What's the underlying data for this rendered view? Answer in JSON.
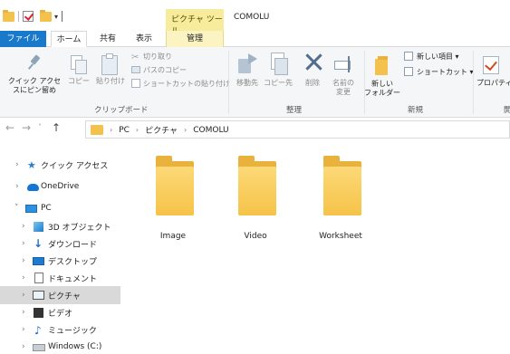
{
  "titlebar": {
    "context_tools": "ピクチャ ツール",
    "window_title": "COMOLU"
  },
  "tabs": {
    "file": "ファイル",
    "home": "ホーム",
    "share": "共有",
    "view": "表示",
    "manage": "管理"
  },
  "ribbon": {
    "clipboard": {
      "pin_line1": "クイック アクセ",
      "pin_line2": "スにピン留め",
      "copy": "コピー",
      "paste": "貼り付け",
      "cut": "切り取り",
      "copy_path": "パスのコピー",
      "paste_shortcut": "ショートカットの貼り付け",
      "group_label": "クリップボード"
    },
    "organize": {
      "move_to": "移動先",
      "copy_to": "コピー先",
      "delete": "削除",
      "rename_line1": "名前の",
      "rename_line2": "変更",
      "group_label": "整理"
    },
    "new": {
      "new_folder_line1": "新しい",
      "new_folder_line2": "フォルダー",
      "new_item": "新しい項目 ▾",
      "easy_access": "ショートカット ▾",
      "group_label": "新規"
    },
    "open": {
      "properties": "プロパティ",
      "group_label": "開"
    }
  },
  "address": {
    "crumbs": [
      "PC",
      "ピクチャ",
      "COMOLU"
    ],
    "sep": "›"
  },
  "navpane": {
    "items": [
      {
        "label": "クイック アクセス",
        "icon": "star-icon"
      },
      {
        "label": "OneDrive",
        "icon": "cloud-icon"
      },
      {
        "label": "PC",
        "icon": "pc-icon"
      },
      {
        "label": "3D オブジェクト",
        "icon": "3d-objects-icon"
      },
      {
        "label": "ダウンロード",
        "icon": "download-icon"
      },
      {
        "label": "デスクトップ",
        "icon": "desktop-icon"
      },
      {
        "label": "ドキュメント",
        "icon": "documents-icon"
      },
      {
        "label": "ピクチャ",
        "icon": "pictures-icon"
      },
      {
        "label": "ビデオ",
        "icon": "videos-icon"
      },
      {
        "label": "ミュージック",
        "icon": "music-icon"
      },
      {
        "label": "Windows (C:)",
        "icon": "drive-icon"
      }
    ]
  },
  "content": {
    "folders": [
      "Image",
      "Video",
      "Worksheet"
    ]
  },
  "colors": {
    "file_tab": "#1979ca",
    "context_tab": "#f7ec9c",
    "folder": "#f3c24d",
    "selected_row": "#d9d9d9"
  }
}
